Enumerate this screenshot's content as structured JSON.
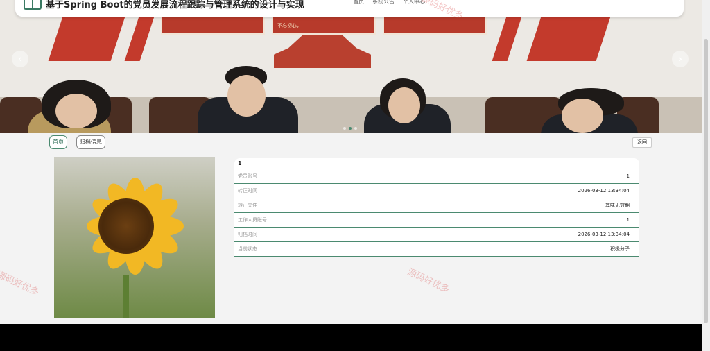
{
  "header": {
    "title": "基于Spring Boot的党员发展流程跟踪与管理系统的设计与实现",
    "nav": [
      "首页",
      "系统公告",
      "个人中心"
    ]
  },
  "banner": {
    "prev_arrow": "‹",
    "next_arrow": "›",
    "slogan_text": "不忘初心，"
  },
  "breadcrumb": {
    "home": "首页",
    "current": "归档信息"
  },
  "back_button": "返回",
  "detail": {
    "heading": "1",
    "rows": [
      {
        "label": "党员账号",
        "value": "1"
      },
      {
        "label": "转正时间",
        "value": "2026-03-12 13:34:04"
      },
      {
        "label": "转正文件",
        "value": "其味无穷翻"
      },
      {
        "label": "工作人员账号",
        "value": "1"
      },
      {
        "label": "归档时间",
        "value": "2026-03-12 13:34:04"
      },
      {
        "label": "当前状态",
        "value": "积极分子"
      }
    ]
  },
  "watermark": "源码好优多",
  "colors": {
    "accent": "#4b8a70",
    "banner_red": "#c33a2c",
    "sunflower": "#f2b824"
  }
}
